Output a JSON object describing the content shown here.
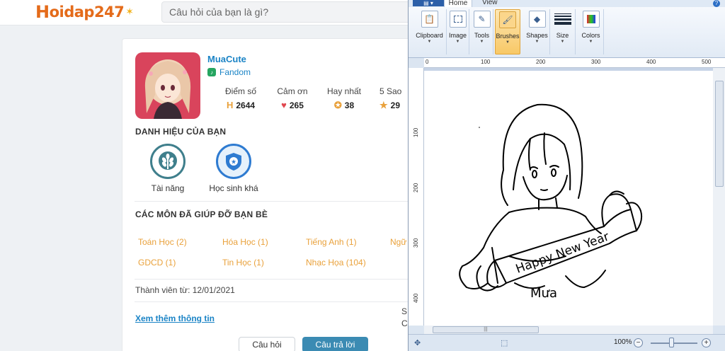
{
  "site": {
    "logo": {
      "prefix": "H",
      "text": "oidap247",
      "spark": "✶"
    },
    "search": {
      "placeholder": "Câu hỏi của bạn là gì?"
    },
    "profile": {
      "username": "MuaCute",
      "rank": "Fandom",
      "stats": [
        {
          "label": "Điểm số",
          "value": "2644",
          "icon": "h-logo-icon",
          "color": "#e9a13b"
        },
        {
          "label": "Cảm ơn",
          "value": "265",
          "icon": "heart-icon",
          "color": "#e0474f"
        },
        {
          "label": "Hay nhất",
          "value": "38",
          "icon": "medal-icon",
          "color": "#e9a13b"
        },
        {
          "label": "5 Sao",
          "value": "29",
          "icon": "star-icon",
          "color": "#e9a13b"
        }
      ]
    },
    "titles": {
      "heading": "DANH HIỆU CỦA BẠN",
      "badges": [
        {
          "label": "Tài năng",
          "icon": "wheat-icon",
          "color": "#3f7f8c"
        },
        {
          "label": "Học sinh khá",
          "icon": "shield-star-icon",
          "color": "#2e7bd1"
        }
      ]
    },
    "subjects": {
      "heading": "CÁC MÔN ĐÃ GIÚP ĐỠ BẠN BÈ",
      "items": [
        "Toán Học (2)",
        "Hóa Học (1)",
        "Tiếng Anh (1)",
        "Ngữ",
        "GDCD (1)",
        "Tin Học (1)",
        "Nhạc Họa (104)"
      ]
    },
    "member_since": "Thành viên từ: 12/01/2021",
    "more_link": "Xem thêm thông tin",
    "partial_text": [
      "S",
      "C"
    ],
    "tabs": {
      "questions": "Câu hỏi",
      "answers": "Câu trả lời"
    }
  },
  "paint": {
    "app_menu": "▤ ▾",
    "tabs": [
      "Home",
      "View"
    ],
    "help": "?",
    "groups": [
      {
        "label": "Clipboard",
        "icon": "clipboard-icon"
      },
      {
        "label": "Image",
        "icon": "image-select-icon"
      },
      {
        "label": "Tools",
        "icon": "tools-icon"
      },
      {
        "label": "Brushes",
        "icon": "brush-icon"
      },
      {
        "label": "Shapes",
        "icon": "shapes-icon"
      },
      {
        "label": "Size",
        "icon": "size-icon"
      },
      {
        "label": "Colors",
        "icon": "colors-icon"
      }
    ],
    "active_group": "Brushes",
    "ruler_h": [
      "0",
      "100",
      "200",
      "300",
      "400",
      "500"
    ],
    "ruler_v": [
      "100",
      "200",
      "300",
      "400"
    ],
    "drawing_text": {
      "banner": "Happy New Year",
      "signature": "Mưa"
    },
    "zoom": "100%",
    "zoom_minus": "−",
    "zoom_plus": "+"
  }
}
